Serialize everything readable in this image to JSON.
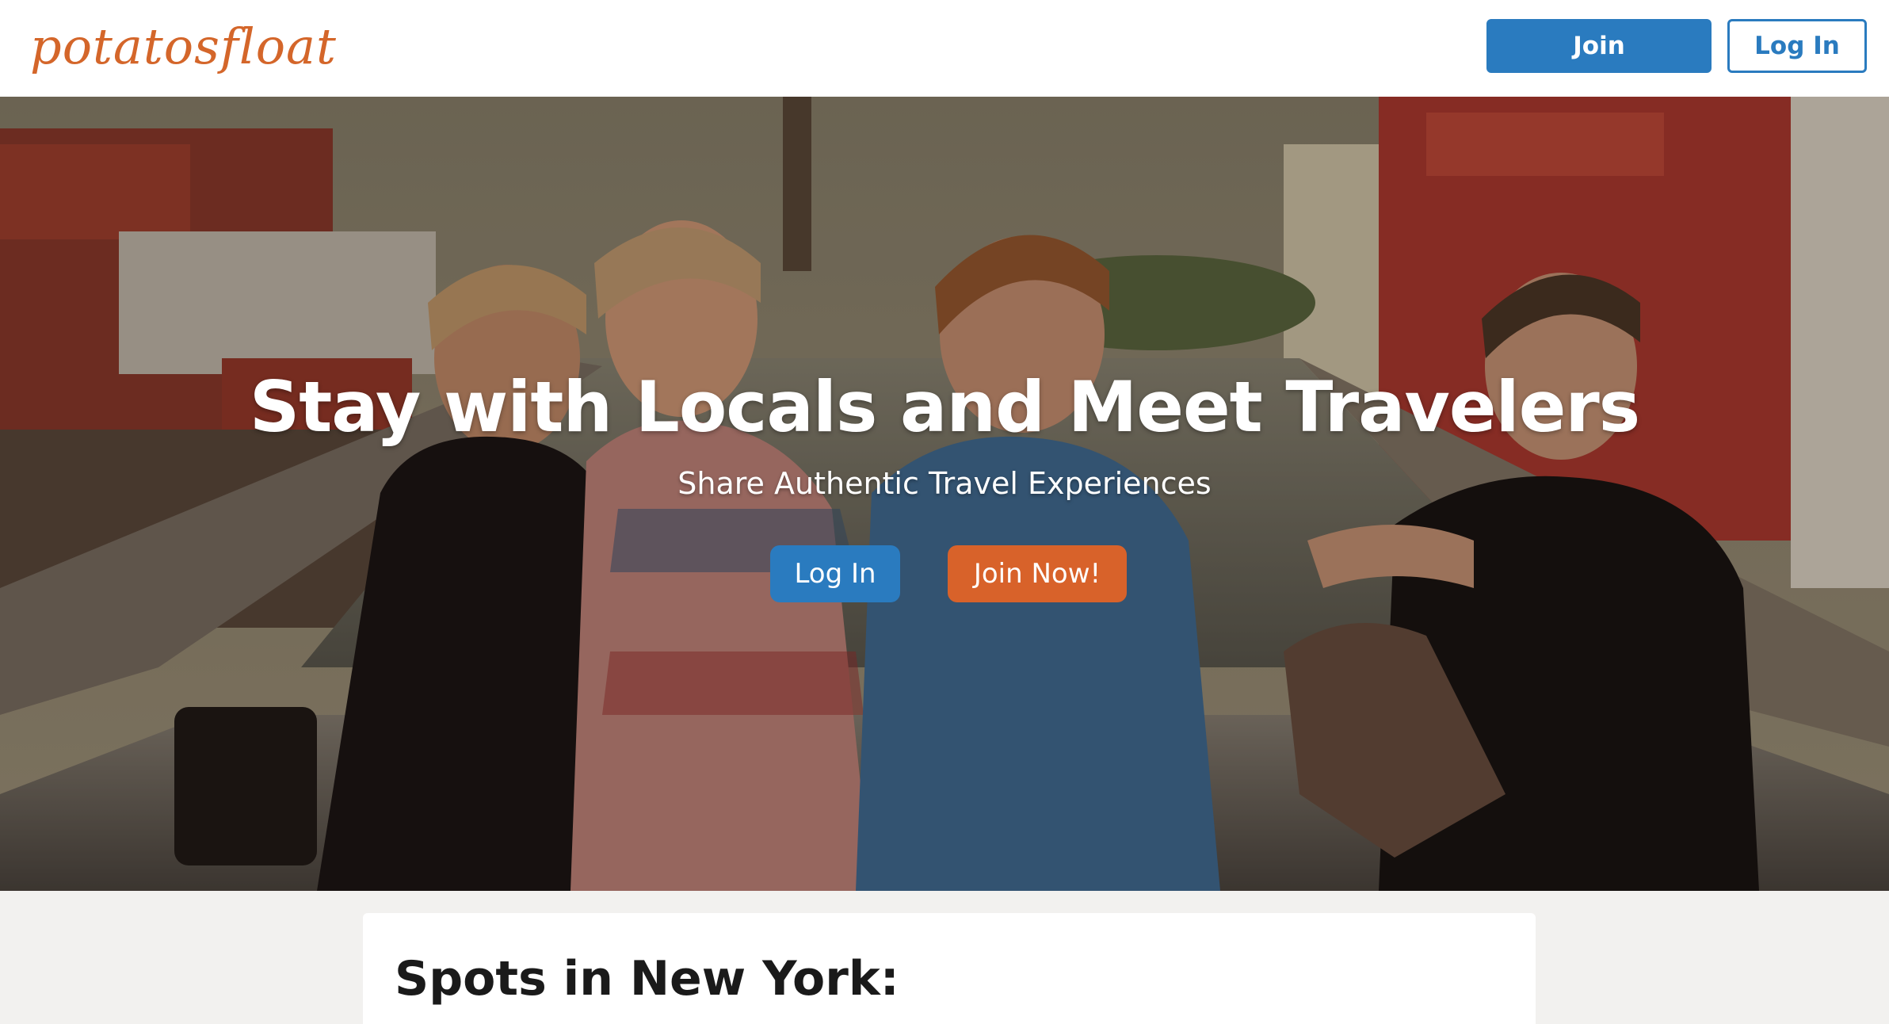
{
  "brand": {
    "logo_text": "potatosfloat",
    "accent_color": "#d4662a",
    "primary_color": "#2a7bbf"
  },
  "nav": {
    "join_label": "Join",
    "login_label": "Log In"
  },
  "hero": {
    "title": "Stay with Locals and Meet Travelers",
    "subtitle": "Share Authentic Travel Experiences",
    "login_label": "Log In",
    "join_label": "Join Now!",
    "join_color": "#d8622a"
  },
  "content": {
    "section_title": "Spots in New York:"
  }
}
